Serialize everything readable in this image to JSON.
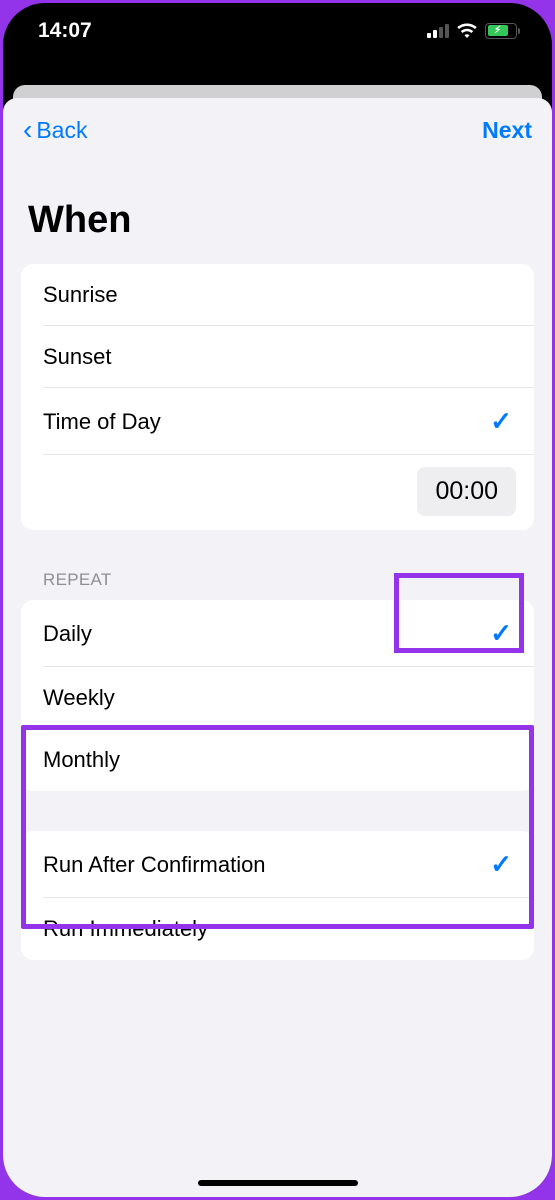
{
  "status": {
    "time": "14:07"
  },
  "nav": {
    "back_label": "Back",
    "next_label": "Next"
  },
  "title": "When",
  "when_options": [
    {
      "label": "Sunrise",
      "selected": false
    },
    {
      "label": "Sunset",
      "selected": false
    },
    {
      "label": "Time of Day",
      "selected": true
    }
  ],
  "time_value": "00:00",
  "repeat_header": "Repeat",
  "repeat_options": [
    {
      "label": "Daily",
      "selected": true
    },
    {
      "label": "Weekly",
      "selected": false
    },
    {
      "label": "Monthly",
      "selected": false
    }
  ],
  "run_options": [
    {
      "label": "Run After Confirmation",
      "selected": true
    },
    {
      "label": "Run Immediately",
      "selected": false
    }
  ]
}
